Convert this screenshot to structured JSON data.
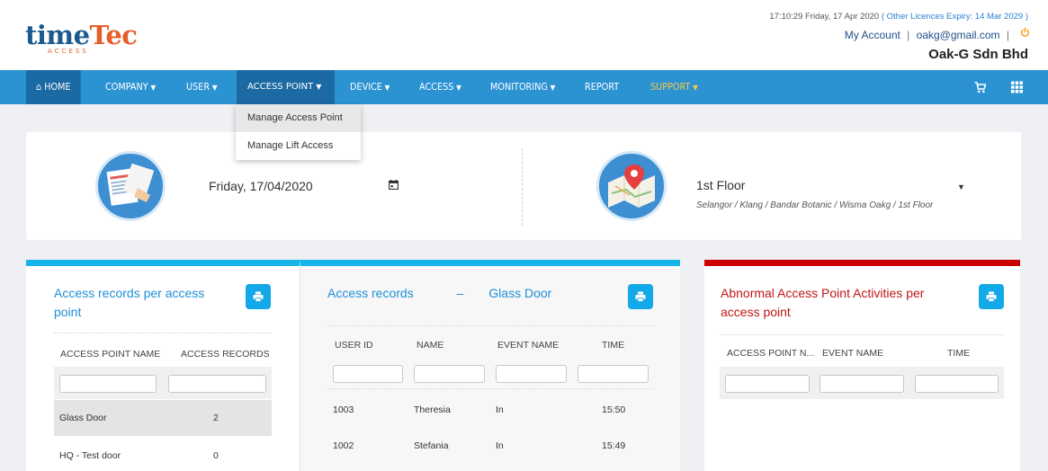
{
  "header": {
    "logo_main": "time",
    "logo_accent": "Tec",
    "logo_sub": "ACCESS",
    "datetime": "17:10:29 Friday, 17 Apr 2020",
    "licence_text": "( Other Licences Expiry: 14 Mar 2029 )",
    "my_account": "My Account",
    "separator": "|",
    "email": "oakg@gmail.com",
    "company": "Oak-G Sdn Bhd"
  },
  "nav": {
    "home": "HOME",
    "company": "COMPANY",
    "user": "USER",
    "access_point": "ACCESS POINT",
    "device": "DEVICE",
    "access": "ACCESS",
    "monitoring": "MONITORING",
    "report": "REPORT",
    "support": "SUPPORT",
    "caret": "▼",
    "icons": [
      "home-icon",
      "cart-icon",
      "grid-icon"
    ]
  },
  "dropdown": {
    "items": [
      "Manage Access Point",
      "Manage Lift Access"
    ]
  },
  "top_panel": {
    "date_value": "Friday, 17/04/2020",
    "floor_value": "1st Floor",
    "floor_path": "Selangor / Klang / Bandar Botanic / Wisma Oakg / 1st Floor"
  },
  "card1": {
    "title_line1": "Access records per access",
    "title_line2": "point",
    "col_name": "ACCESS POINT NAME",
    "col_records": "ACCESS RECORDS",
    "rows": [
      {
        "name": "Glass Door",
        "records": "2"
      },
      {
        "name": "HQ - Test door",
        "records": "0"
      }
    ]
  },
  "card2": {
    "title": "Access records",
    "dash": "–",
    "title_door": "Glass Door",
    "col_user_id": "USER ID",
    "col_name": "NAME",
    "col_event": "EVENT NAME",
    "col_time": "TIME",
    "rows": [
      {
        "user_id": "1003",
        "name": "Theresia",
        "event": "In",
        "time": "15:50"
      },
      {
        "user_id": "1002",
        "name": "Stefania",
        "event": "In",
        "time": "15:49"
      }
    ]
  },
  "card3": {
    "title_line1": "Abnormal Access Point Activities per",
    "title_line2": "access point",
    "col_ap_name": "ACCESS POINT N...",
    "col_event": "EVENT NAME",
    "col_time": "TIME"
  },
  "colors": {
    "nav_bg": "#2c93d3",
    "nav_active": "#1c6aa3",
    "accent_blue": "#15b6ea",
    "alert_red": "#cc0000",
    "support_gold": "#f7c94b",
    "logo_orange": "#e65d2a"
  }
}
